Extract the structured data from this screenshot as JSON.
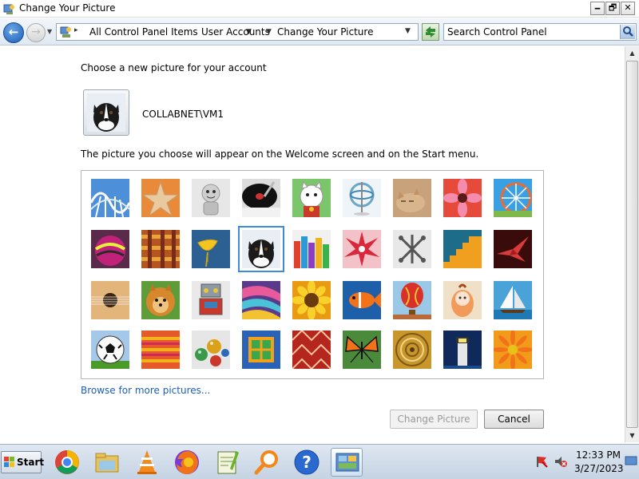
{
  "window": {
    "title": "Change Your Picture",
    "minimize_glyph": "🗕",
    "maximize_glyph": "🗗",
    "close_glyph": "✕"
  },
  "address": {
    "breadcrumbs": [
      "All Control Panel Items",
      "User Accounts",
      "Change Your Picture"
    ],
    "search_placeholder": "Search Control Panel"
  },
  "content": {
    "heading": "Choose a new picture for your account",
    "user_name": "COLLABNET\\VM1",
    "description": "The picture you choose will appear on the Welcome screen and on the Start menu.",
    "pictures": [
      "roller-coaster",
      "starfish",
      "robot-toy",
      "turntable",
      "lucky-cat",
      "gyroscope",
      "kitten",
      "pink-flower",
      "ferris-wheel",
      "bowling-ball",
      "fabric-weave",
      "ginkgo-leaf",
      "border-collie",
      "crayons",
      "star-decoration",
      "jacks",
      "stairs",
      "paper-crane",
      "guitar",
      "pomeranian",
      "tin-robot",
      "fabric-folds",
      "sunflower",
      "tropical-fish",
      "hot-air-balloon",
      "doll",
      "sailboat",
      "soccer-ball",
      "fabric-stripes",
      "marbles",
      "window",
      "woven-textile",
      "monarch-butterfly",
      "shell-pattern",
      "lighthouse",
      "orange-daisy"
    ],
    "selected_picture": "border-collie",
    "browse_link": "Browse for more pictures...",
    "change_button": "Change Picture",
    "cancel_button": "Cancel"
  },
  "taskbar": {
    "start_label": "Start",
    "apps": [
      "chrome",
      "file-explorer",
      "vlc",
      "firefox",
      "notepad-plus-plus",
      "search-magnifier",
      "help",
      "control-panel"
    ],
    "active_app": "control-panel",
    "clock_time": "12:33 PM",
    "clock_date": "3/27/2023"
  },
  "colors": {
    "accent": "#3c8ad8",
    "link": "#1c5fb8"
  }
}
